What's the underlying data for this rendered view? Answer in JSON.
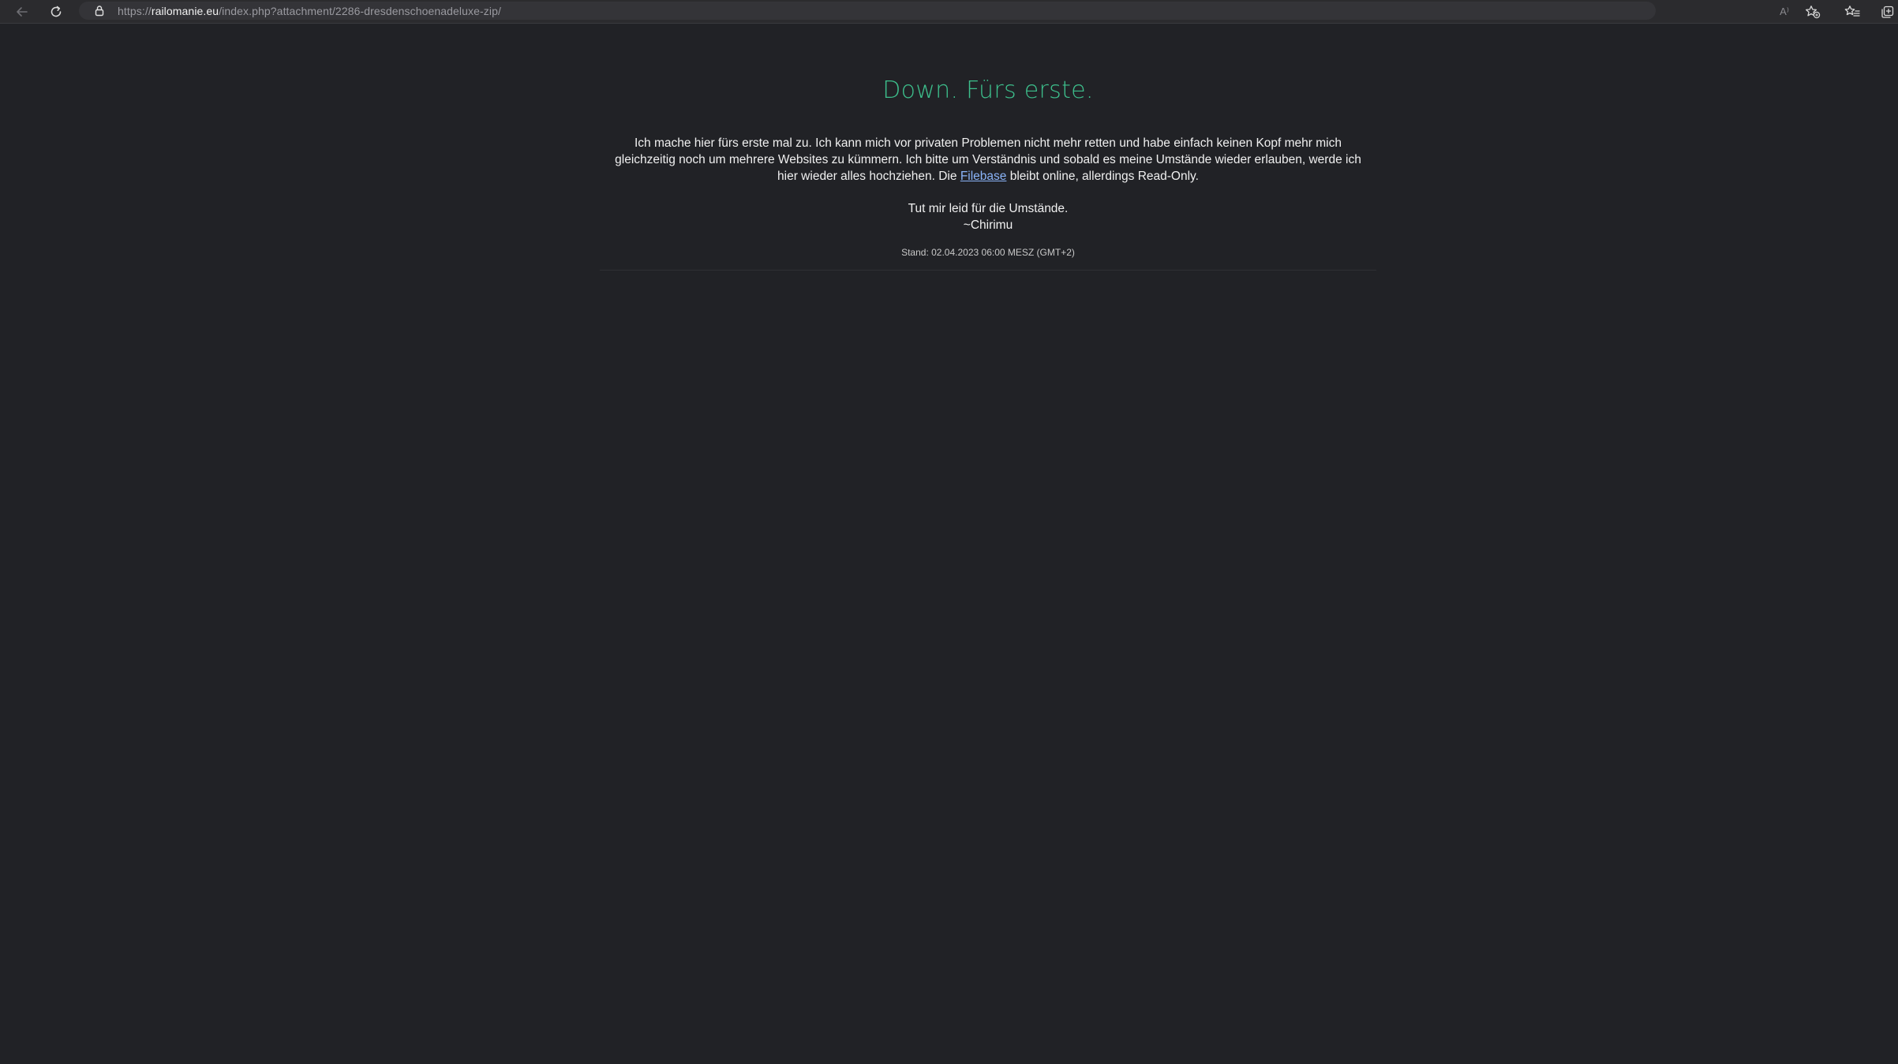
{
  "browser": {
    "url_scheme": "https://",
    "url_host": "railomanie.eu",
    "url_path": "/index.php?attachment/2286-dresdenschoenadeluxe-zip/",
    "read_aloud_label": "A⁾"
  },
  "page": {
    "headline": "Down. Fürs erste.",
    "message_part1": "Ich mache hier fürs erste mal zu. Ich kann mich vor privaten Problemen nicht mehr retten und habe einfach keinen Kopf mehr mich gleichzeitig noch um mehrere Websites zu kümmern. Ich bitte um Verständnis und sobald es meine Umstände wieder erlauben, werde ich hier wieder alles hochziehen. Die ",
    "filebase_link": "Filebase",
    "message_part2": " bleibt online, allerdings Read-Only.",
    "sorry_line": "Tut mir leid für die Umstände.",
    "signature": "~Chirimu",
    "stand": "Stand: 02.04.2023 06:00 MESZ (GMT+2)"
  },
  "colors": {
    "background": "#212226",
    "headline": "#3dbf8c",
    "link": "#8ab4f8"
  }
}
